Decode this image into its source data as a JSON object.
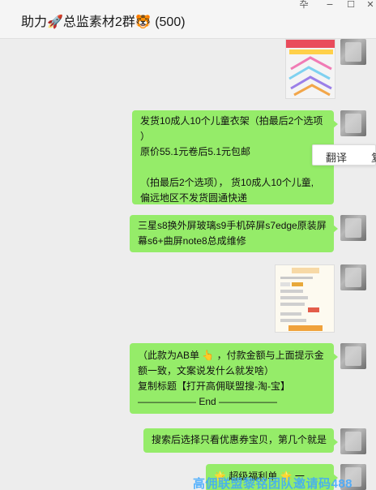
{
  "window": {
    "title": "助力🚀总监素材2群🐯 (500)",
    "controls": [
      "卆",
      "−",
      "☐",
      "✕"
    ]
  },
  "messages": [
    {
      "type": "image",
      "desc_icon": "hanger-product-image"
    },
    {
      "type": "text",
      "lines": [
        "发货10成人10个儿童衣架（拍最后2个选项",
        "）",
        "原价55.1元卷后5.1元包邮",
        "",
        "（拍最后2个选项）， 货10成人10个儿童,",
        "偏远地区不发货圆通快递"
      ]
    },
    {
      "type": "text",
      "lines": [
        "三星s8换外屏玻璃s9手机碎屏s7edge原装屏",
        "幕s6+曲屏note8总成维修"
      ]
    },
    {
      "type": "image",
      "desc_icon": "coupon-screenshot-image"
    },
    {
      "type": "text",
      "lines": [
        "（此款为AB单 👆 ，付款金额与上面提示金",
        "额一致，文案说发什么就发啥）",
        "复制标题【打开高佣联盟搜-淘-宝】",
        "——————  End  ——————"
      ]
    },
    {
      "type": "text",
      "lines": [
        "搜索后选择只看优惠券宝贝，第几个就是"
      ]
    },
    {
      "type": "text",
      "lines": [
        "🌟 超级福利单 🌟 一"
      ]
    }
  ],
  "context_menu": {
    "translate_label": "翻译",
    "second_label": "复"
  },
  "watermark_text": "高佣联盟黎铭团队邀请码488",
  "colors": {
    "bubble": "#95ec69",
    "background": "#ededed"
  }
}
